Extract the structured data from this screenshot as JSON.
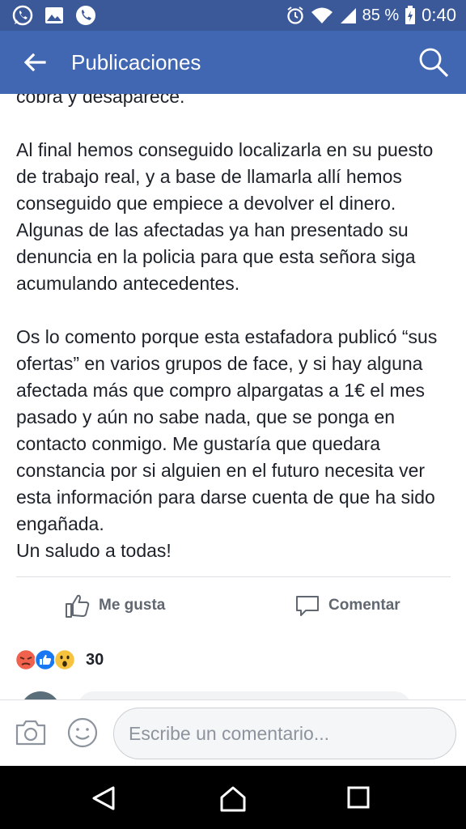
{
  "status_bar": {
    "battery": "85 %",
    "time": "0:40",
    "left_icons": [
      "whatsapp-icon",
      "image-icon",
      "phone-icon"
    ],
    "right_icons": [
      "alarm-icon",
      "wifi-icon",
      "signal-icon",
      "battery-icon"
    ]
  },
  "app_bar": {
    "title": "Publicaciones",
    "back_icon": "arrow-left-icon",
    "search_icon": "search-icon"
  },
  "post": {
    "paragraphs": [
      "cobra y desaparece.",
      "Al final hemos conseguido localizarla en su puesto de trabajo real, y a base de llamarla allí hemos conseguido que empiece a devolver el dinero. Algunas de las afectadas ya han presentado su denuncia en la policia para que esta señora siga acumulando antecedentes.",
      "Os lo comento porque esta estafadora publicó “sus ofertas” en varios grupos de face, y si hay alguna afectada más que compro alpargatas a 1€ el mes pasado y aún no sabe nada, que se ponga en contacto conmigo. Me gustaría que quedara constancia por si alguien en el futuro necesita ver esta información para darse cuenta de que ha sido engañada.\nUn saludo a todas!"
    ]
  },
  "actions": {
    "like_label": "Me gusta",
    "comment_label": "Comentar"
  },
  "reactions": {
    "types": [
      "angry",
      "like",
      "wow"
    ],
    "count": "30"
  },
  "composer": {
    "placeholder": "Escribe un comentario..."
  },
  "colors": {
    "status_bar": "#3b5998",
    "app_bar": "#4267b2",
    "text": "#1d2129",
    "action_text": "#606770",
    "like_blue": "#1877f2",
    "angry": "#f0624e",
    "wow": "#f7c33f"
  }
}
